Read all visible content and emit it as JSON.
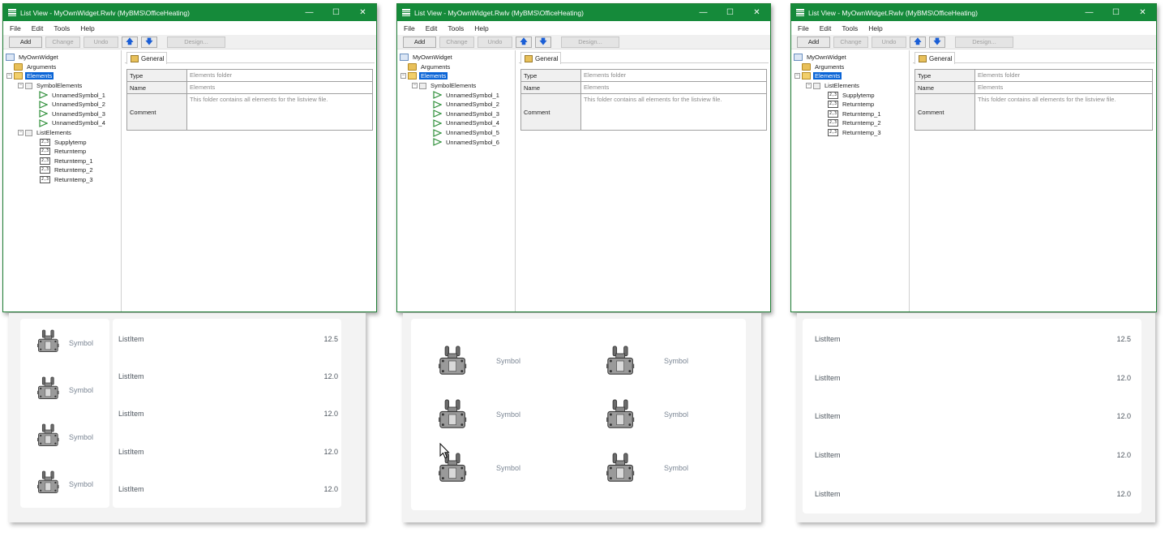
{
  "window": {
    "title": "List View - MyOwnWidget.Rwlv (MyBMS\\OfficeHeating)",
    "controls": {
      "minimize": "—",
      "maximize": "☐",
      "close": "✕"
    },
    "menu": [
      "File",
      "Edit",
      "Tools",
      "Help"
    ],
    "toolbar": {
      "add": "Add",
      "change": "Change",
      "undo": "Undo",
      "up": "🡅",
      "down": "🡇",
      "design": "Design..."
    },
    "tab": "General",
    "props": {
      "type_label": "Type",
      "type_value": "Elements folder",
      "name_label": "Name",
      "name_value": "Elements",
      "comment_label": "Comment",
      "comment_value": "This folder contains all elements for the listview file."
    },
    "tree_common": {
      "root": "MyOwnWidget",
      "arguments": "Arguments",
      "elements": "Elements"
    }
  },
  "panel1": {
    "symbol_group": "SymbolElements",
    "symbols": [
      "UnnamedSymbol_1",
      "UnnamedSymbol_2",
      "UnnamedSymbol_3",
      "UnnamedSymbol_4"
    ],
    "list_group": "ListElements",
    "list_items": [
      "Supplytemp",
      "Returntemp",
      "Returntemp_1",
      "Returntemp_2",
      "Returntemp_3"
    ],
    "preview": {
      "symbol_label": "Symbol",
      "list_label": "ListItem",
      "values": [
        "12.5",
        "12.0",
        "12.0",
        "12.0",
        "12.0"
      ]
    }
  },
  "panel2": {
    "symbol_group": "SymbolElements",
    "symbols": [
      "UnnamedSymbol_1",
      "UnnamedSymbol_2",
      "UnnamedSymbol_3",
      "UnnamedSymbol_4",
      "UnnamedSymbol_5",
      "UnnamedSymbol_6"
    ],
    "preview": {
      "symbol_label": "Symbol"
    }
  },
  "panel3": {
    "list_group": "ListElements",
    "list_items": [
      "Supplytemp",
      "Returntemp",
      "Returntemp_1",
      "Returntemp_2",
      "Returntemp_3"
    ],
    "preview": {
      "list_label": "ListItem",
      "values": [
        "12.5",
        "12.0",
        "12.0",
        "12.0",
        "12.0"
      ]
    }
  },
  "icon_badge": "2,3"
}
